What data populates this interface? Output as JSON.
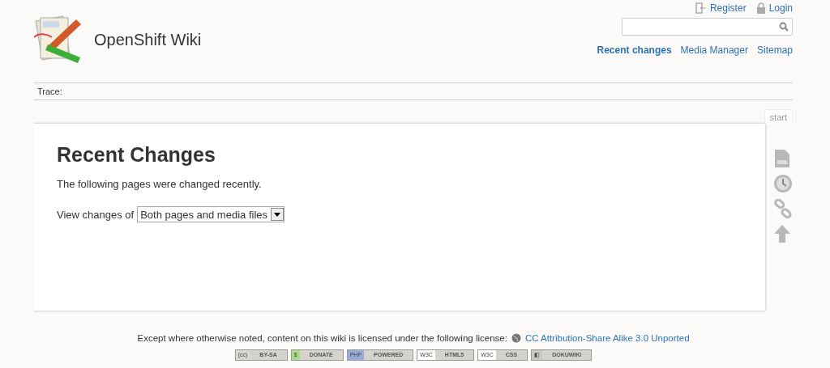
{
  "site": {
    "title": "OpenShift Wiki"
  },
  "user_tools": [
    {
      "kind": "register",
      "label": "Register"
    },
    {
      "kind": "login",
      "label": "Login"
    }
  ],
  "site_tools": [
    {
      "label": "Recent changes",
      "selected": true
    },
    {
      "label": "Media Manager",
      "selected": false
    },
    {
      "label": "Sitemap",
      "selected": false
    }
  ],
  "breadcrumbs": {
    "label": "Trace:"
  },
  "page_tab": "start",
  "page": {
    "heading": "Recent Changes",
    "intro": "The following pages were changed recently.",
    "filter_label": "View changes of",
    "filter_value": "Both pages and media files"
  },
  "page_tools": [
    {
      "kind": "page"
    },
    {
      "kind": "history"
    },
    {
      "kind": "backlinks"
    },
    {
      "kind": "top"
    }
  ],
  "footer": {
    "license_text": "Except where otherwise noted, content on this wiki is licensed under the following license:",
    "license_link": "CC Attribution-Share Alike 3.0 Unported"
  },
  "badges": [
    {
      "left": "(cc)",
      "right": "BY-SA",
      "color": "#d8d8d0"
    },
    {
      "left": "$",
      "right": "DONATE",
      "color": "#a8dc88"
    },
    {
      "left": "PHP",
      "right": "POWERED",
      "color": "#98acd8"
    },
    {
      "left": "W3C",
      "right": "HTML5",
      "color": "#ffffff"
    },
    {
      "left": "W3C",
      "right": "CSS",
      "color": "#ffffff"
    },
    {
      "left": "◧",
      "right": "DOKUWIKI",
      "color": "#c8c8c0"
    }
  ]
}
